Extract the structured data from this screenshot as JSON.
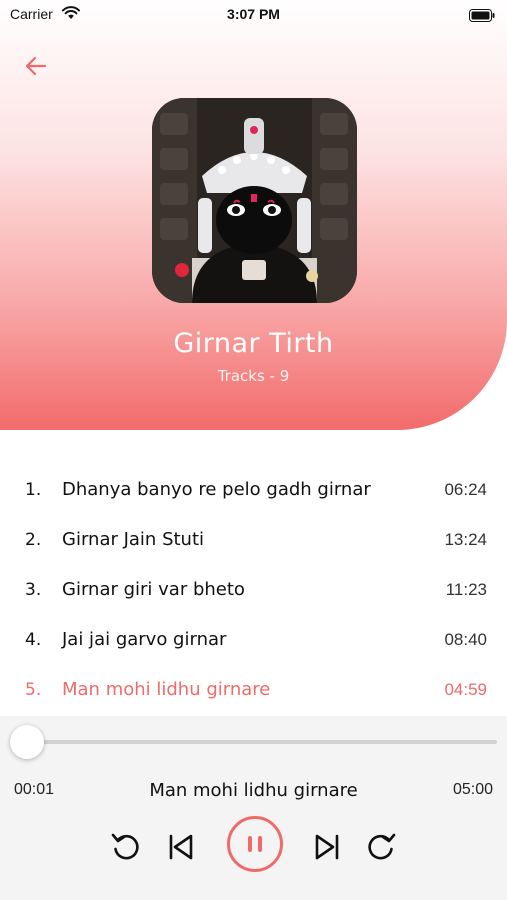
{
  "status_bar": {
    "carrier": "Carrier",
    "time": "3:07 PM"
  },
  "album": {
    "title": "Girnar Tirth",
    "tracks_label": "Tracks - 9"
  },
  "tracks": [
    {
      "num": "1.",
      "name": "Dhanya banyo re pelo gadh girnar",
      "duration": "06:24"
    },
    {
      "num": "2.",
      "name": "Girnar Jain Stuti",
      "duration": "13:24"
    },
    {
      "num": "3.",
      "name": "Girnar giri var bheto",
      "duration": "11:23"
    },
    {
      "num": "4.",
      "name": "Jai jai garvo girnar",
      "duration": "08:40"
    },
    {
      "num": "5.",
      "name": "Man mohi lidhu girnare",
      "duration": "04:59"
    }
  ],
  "player": {
    "elapsed": "00:01",
    "now_playing": "Man mohi lidhu girnare",
    "total": "05:00",
    "progress_fraction": 0.003
  },
  "colors": {
    "accent": "#f06a6a",
    "header_bottom": "#f26b6b"
  },
  "icons": {
    "back": "arrow-left-icon",
    "replay": "rewind-icon",
    "previous": "skip-previous-icon",
    "pause": "pause-icon",
    "next": "skip-next-icon",
    "forward": "forward-icon"
  }
}
